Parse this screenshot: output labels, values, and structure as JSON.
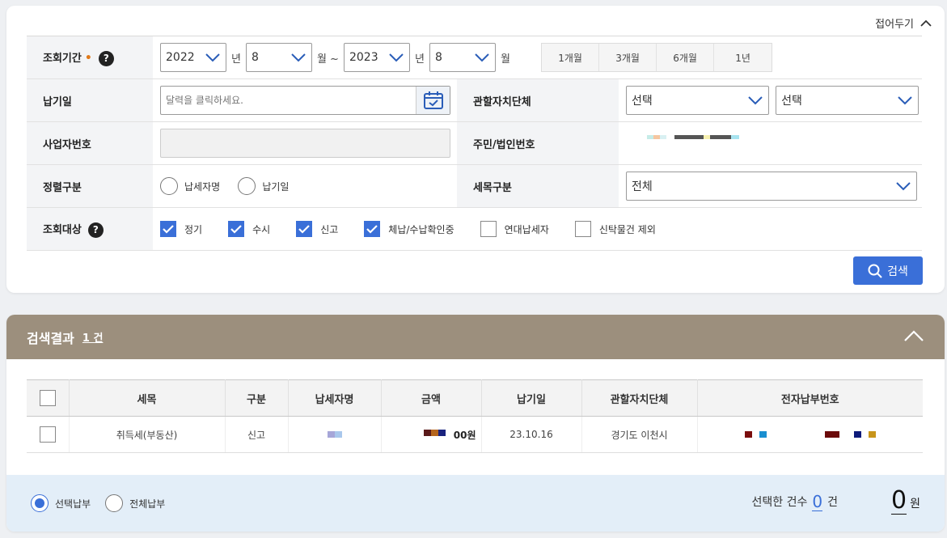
{
  "search_panel": {
    "collapse_label": "접어두기",
    "period": {
      "label": "조회기간",
      "required_mark": "•",
      "start_year": "2022",
      "year_unit": "년",
      "start_month": "8",
      "month_unit_tilde": "월 ~",
      "end_year": "2023",
      "end_year_unit": "년",
      "end_month": "8",
      "end_month_unit": "월",
      "quick": [
        "1개월",
        "3개월",
        "6개월",
        "1년"
      ]
    },
    "pay_date": {
      "label": "납기일",
      "placeholder": "달력을 클릭하세요."
    },
    "jurisdiction": {
      "label": "관할자치단체",
      "select1": "선택",
      "select2": "선택"
    },
    "business_no": {
      "label": "사업자번호"
    },
    "resident_no": {
      "label": "주민/법인번호"
    },
    "sort": {
      "label": "정렬구분",
      "options": [
        "납세자명",
        "납기일"
      ]
    },
    "tax_type": {
      "label": "세목구분",
      "value": "전체"
    },
    "target": {
      "label": "조회대상",
      "options": [
        {
          "label": "정기",
          "checked": true
        },
        {
          "label": "수시",
          "checked": true
        },
        {
          "label": "신고",
          "checked": true
        },
        {
          "label": "체납/수납확인중",
          "checked": true
        },
        {
          "label": "연대납세자",
          "checked": false
        },
        {
          "label": "신탁물건 제외",
          "checked": false
        }
      ]
    },
    "search_button": "검색"
  },
  "results": {
    "title": "검색결과",
    "count": "1 건",
    "columns": [
      "세목",
      "구분",
      "납세자명",
      "금액",
      "납기일",
      "관할자치단체",
      "전자납부번호"
    ],
    "rows": [
      {
        "tax": "취득세(부동산)",
        "type": "신고",
        "amount_suffix": "00원",
        "date": "23.10.16",
        "region": "경기도 이천시"
      }
    ],
    "pay_options": [
      "선택납부",
      "전체납부"
    ],
    "selected_count_label": "선택한 건수",
    "selected_count": "0",
    "count_unit": "건",
    "total": "0",
    "total_unit": "원"
  },
  "colors": {
    "accent": "#3a6fd8",
    "header_bar": "#9c8f7d"
  }
}
